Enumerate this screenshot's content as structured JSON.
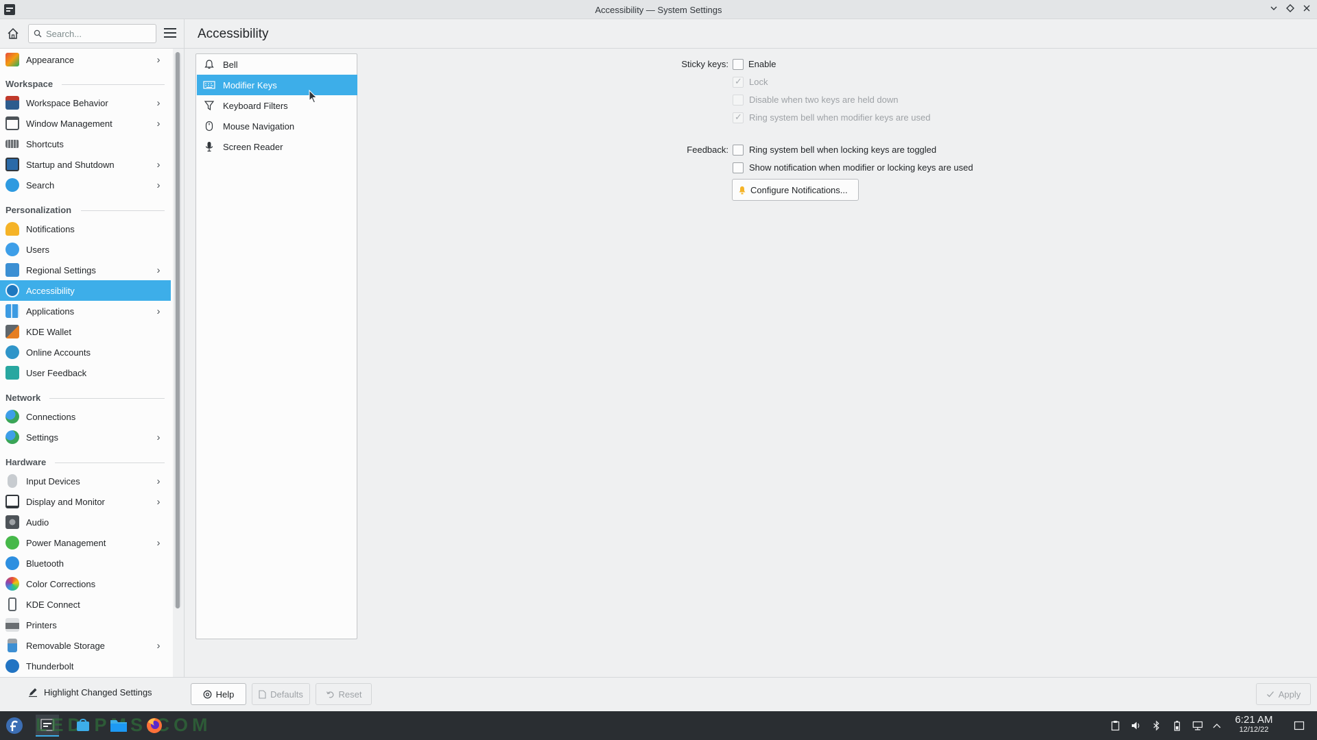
{
  "window": {
    "title": "Accessibility — System Settings"
  },
  "search": {
    "placeholder": "Search..."
  },
  "sidebar": {
    "items": [
      {
        "label": "Appearance",
        "chevron": true,
        "icon": "appearance-icon",
        "color": "#e74c3c"
      },
      {
        "category": "Workspace"
      },
      {
        "label": "Workspace Behavior",
        "chevron": true,
        "icon": "workspace-behavior-icon",
        "color": "#2d5c8e"
      },
      {
        "label": "Window Management",
        "chevron": true,
        "icon": "window-management-icon",
        "color": "#4d5358"
      },
      {
        "label": "Shortcuts",
        "chevron": false,
        "icon": "keyboard-icon",
        "color": "#6a6e72"
      },
      {
        "label": "Startup and Shutdown",
        "chevron": true,
        "icon": "startup-shutdown-icon",
        "color": "#2a6aa8"
      },
      {
        "label": "Search",
        "chevron": true,
        "icon": "search-icon",
        "color": "#2e9ae0"
      },
      {
        "category": "Personalization"
      },
      {
        "label": "Notifications",
        "chevron": false,
        "icon": "bell-icon",
        "color": "#f5b327"
      },
      {
        "label": "Users",
        "chevron": false,
        "icon": "users-icon",
        "color": "#3d9ee8"
      },
      {
        "label": "Regional Settings",
        "chevron": true,
        "icon": "regional-settings-icon",
        "color": "#3b8fd3"
      },
      {
        "label": "Accessibility",
        "chevron": false,
        "icon": "accessibility-icon",
        "color": "#2f8fd8",
        "selected": true
      },
      {
        "label": "Applications",
        "chevron": true,
        "icon": "applications-icon",
        "color": "#3c9be2"
      },
      {
        "label": "KDE Wallet",
        "chevron": false,
        "icon": "kde-wallet-icon",
        "color": "#5f666b"
      },
      {
        "label": "Online Accounts",
        "chevron": false,
        "icon": "online-accounts-icon",
        "color": "#2f95c9"
      },
      {
        "label": "User Feedback",
        "chevron": false,
        "icon": "user-feedback-icon",
        "color": "#28a7a0"
      },
      {
        "category": "Network"
      },
      {
        "label": "Connections",
        "chevron": false,
        "icon": "connections-icon",
        "color": "#3aa557"
      },
      {
        "label": "Settings",
        "chevron": true,
        "icon": "network-settings-icon",
        "color": "#3aa557"
      },
      {
        "category": "Hardware"
      },
      {
        "label": "Input Devices",
        "chevron": true,
        "icon": "mouse-icon",
        "color": "#b5b9bd"
      },
      {
        "label": "Display and Monitor",
        "chevron": true,
        "icon": "monitor-icon",
        "color": "#31363b"
      },
      {
        "label": "Audio",
        "chevron": false,
        "icon": "audio-icon",
        "color": "#4d5358"
      },
      {
        "label": "Power Management",
        "chevron": true,
        "icon": "power-icon",
        "color": "#46b84a"
      },
      {
        "label": "Bluetooth",
        "chevron": false,
        "icon": "bluetooth-icon",
        "color": "#2d8fe0"
      },
      {
        "label": "Color Corrections",
        "chevron": false,
        "icon": "color-corrections-icon",
        "color": "#8e44ad"
      },
      {
        "label": "KDE Connect",
        "chevron": false,
        "icon": "kde-connect-icon",
        "color": "#5f666b"
      },
      {
        "label": "Printers",
        "chevron": false,
        "icon": "printer-icon",
        "color": "#6a6e72"
      },
      {
        "label": "Removable Storage",
        "chevron": true,
        "icon": "removable-storage-icon",
        "color": "#3d8fd3"
      },
      {
        "label": "Thunderbolt",
        "chevron": false,
        "icon": "thunderbolt-icon",
        "color": "#2274c3"
      }
    ]
  },
  "page": {
    "title": "Accessibility"
  },
  "subpages": [
    {
      "label": "Bell",
      "icon": "bell-icon"
    },
    {
      "label": "Modifier Keys",
      "icon": "keyboard-icon",
      "selected": true
    },
    {
      "label": "Keyboard Filters",
      "icon": "filter-icon"
    },
    {
      "label": "Mouse Navigation",
      "icon": "mouse-icon"
    },
    {
      "label": "Screen Reader",
      "icon": "microphone-icon"
    }
  ],
  "form": {
    "sticky_keys_label": "Sticky keys:",
    "enable": {
      "label": "Enable",
      "checked": false
    },
    "lock": {
      "label": "Lock",
      "checked": true,
      "disabled": true
    },
    "disable_two_keys": {
      "label": "Disable when two keys are held down",
      "checked": false,
      "disabled": true
    },
    "ring_modifier": {
      "label": "Ring system bell when modifier keys are used",
      "checked": true,
      "disabled": true
    },
    "feedback_label": "Feedback:",
    "ring_locking": {
      "label": "Ring system bell when locking keys are toggled",
      "checked": false
    },
    "show_notification": {
      "label": "Show notification when modifier or locking keys are used",
      "checked": false
    },
    "configure_notifications": "Configure Notifications..."
  },
  "bottom": {
    "highlight": "Highlight Changed Settings",
    "help": "Help",
    "defaults": "Defaults",
    "reset": "Reset",
    "apply": "Apply"
  },
  "taskbar": {
    "watermark": "LED PMS.COM",
    "time": "6:21 AM",
    "date": "12/12/22"
  }
}
